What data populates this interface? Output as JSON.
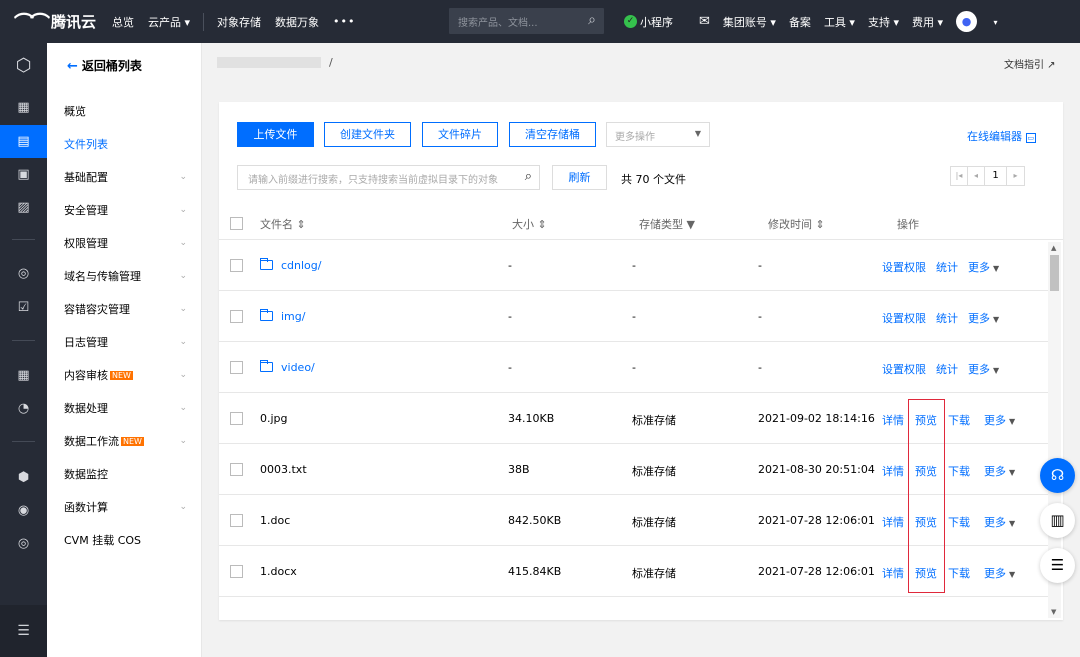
{
  "topbar": {
    "brand": "腾讯云",
    "nav": [
      "总览",
      "云产品 ▾",
      "对象存储",
      "数据万象"
    ],
    "more": "•••",
    "search_placeholder": "搜索产品、文档...",
    "right": {
      "miniapp": "小程序",
      "group": "集团账号 ▾",
      "filing": "备案",
      "tools": "工具 ▾",
      "support": "支持 ▾",
      "fees": "费用 ▾"
    }
  },
  "sidebar": {
    "back": "返回桶列表",
    "items": [
      {
        "label": "概览",
        "chevron": ""
      },
      {
        "label": "文件列表",
        "chevron": ""
      },
      {
        "label": "基础配置",
        "chevron": "⌄"
      },
      {
        "label": "安全管理",
        "chevron": "⌄"
      },
      {
        "label": "权限管理",
        "chevron": "⌄"
      },
      {
        "label": "域名与传输管理",
        "chevron": "⌄"
      },
      {
        "label": "容错容灾管理",
        "chevron": "⌄"
      },
      {
        "label": "日志管理",
        "chevron": "⌄"
      },
      {
        "label": "内容审核",
        "chevron": "⌄",
        "badge": "NEW"
      },
      {
        "label": "数据处理",
        "chevron": "⌄"
      },
      {
        "label": "数据工作流",
        "chevron": "⌄",
        "badge": "NEW"
      },
      {
        "label": "数据监控",
        "chevron": ""
      },
      {
        "label": "函数计算",
        "chevron": "⌄"
      },
      {
        "label": "CVM 挂载 COS",
        "chevron": ""
      }
    ]
  },
  "breadcrumb": {
    "sep": "/"
  },
  "doc_guide": "文档指引 ↗",
  "toolbar": {
    "upload": "上传文件",
    "mkdir": "创建文件夹",
    "fragments": "文件碎片",
    "clear": "清空存储桶",
    "more": "更多操作",
    "editor": "在线编辑器"
  },
  "search": {
    "placeholder": "请输入前缀进行搜索，只支持搜索当前虚拟目录下的对象",
    "refresh": "刷新",
    "count": "共 70 个文件"
  },
  "pager": {
    "first": "|◂",
    "prev": "◂",
    "page": "1",
    "next": "▸"
  },
  "table": {
    "headers": {
      "name": "文件名 ⇕",
      "size": "大小 ⇕",
      "storage": "存储类型 ▼",
      "time": "修改时间 ⇕",
      "ops": "操作"
    },
    "rows": [
      {
        "name": "cdnlog/",
        "size": "-",
        "storage": "-",
        "time": "-",
        "folder": true,
        "ops": [
          "设置权限",
          "统计",
          "更多"
        ]
      },
      {
        "name": "img/",
        "size": "-",
        "storage": "-",
        "time": "-",
        "folder": true,
        "ops": [
          "设置权限",
          "统计",
          "更多"
        ]
      },
      {
        "name": "video/",
        "size": "-",
        "storage": "-",
        "time": "-",
        "folder": true,
        "ops": [
          "设置权限",
          "统计",
          "更多"
        ]
      },
      {
        "name": "0.jpg",
        "size": "34.10KB",
        "storage": "标准存储",
        "time": "2021-09-02 18:14:16",
        "folder": false,
        "ops": [
          "详情",
          "预览",
          "下载",
          "更多"
        ]
      },
      {
        "name": "0003.txt",
        "size": "38B",
        "storage": "标准存储",
        "time": "2021-08-30 20:51:04",
        "folder": false,
        "ops": [
          "详情",
          "预览",
          "下载",
          "更多"
        ]
      },
      {
        "name": "1.doc",
        "size": "842.50KB",
        "storage": "标准存储",
        "time": "2021-07-28 12:06:01",
        "folder": false,
        "ops": [
          "详情",
          "预览",
          "下载",
          "更多"
        ]
      },
      {
        "name": "1.docx",
        "size": "415.84KB",
        "storage": "标准存储",
        "time": "2021-07-28 12:06:01",
        "folder": false,
        "ops": [
          "详情",
          "预览",
          "下载",
          "更多"
        ]
      }
    ]
  },
  "colors": {
    "accent": "#006eff",
    "topbar": "#262b36",
    "highlight": "#e0283b",
    "badge": "#ff7200"
  }
}
